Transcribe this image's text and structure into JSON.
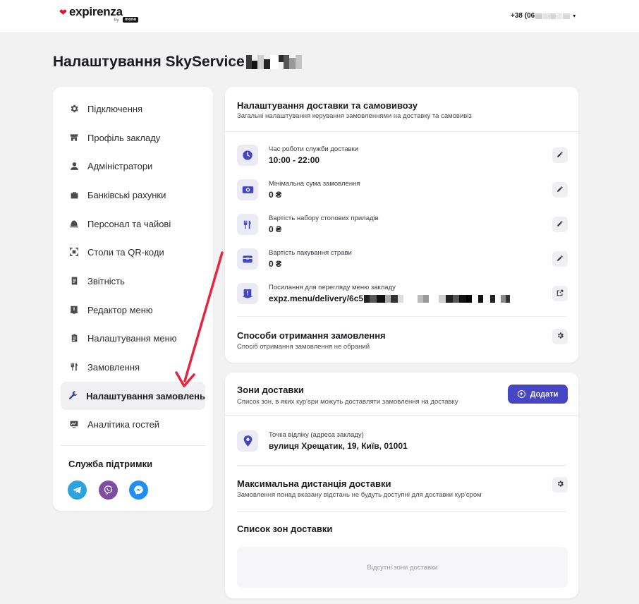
{
  "header": {
    "logo_text": "expirenza",
    "logo_by": "by",
    "logo_mono": "mono",
    "phone_prefix": "+38 (06"
  },
  "page": {
    "title": "Налаштування SkyService"
  },
  "sidebar": {
    "items": [
      {
        "label": "Підключення",
        "icon": "gear-icon"
      },
      {
        "label": "Профіль закладу",
        "icon": "store-icon"
      },
      {
        "label": "Адміністратори",
        "icon": "person-icon"
      },
      {
        "label": "Банківські рахунки",
        "icon": "briefcase-icon"
      },
      {
        "label": "Персонал та чайові",
        "icon": "bell-icon"
      },
      {
        "label": "Столи та QR-коди",
        "icon": "qr-scan-icon"
      },
      {
        "label": "Звітність",
        "icon": "document-icon"
      },
      {
        "label": "Редактор меню",
        "icon": "book-icon"
      },
      {
        "label": "Налаштування меню",
        "icon": "clipboard-icon"
      },
      {
        "label": "Замовлення",
        "icon": "cutlery-icon"
      },
      {
        "label": "Налаштування замовлень",
        "icon": "wrench-icon",
        "active": true
      },
      {
        "label": "Аналітика гостей",
        "icon": "analytics-icon"
      }
    ],
    "support_title": "Служба підтримки",
    "support_channels": [
      "telegram-icon",
      "viber-icon",
      "messenger-icon"
    ]
  },
  "delivery_settings": {
    "title": "Налаштування доставки та самовивозу",
    "subtitle": "Загальні налаштування керування замовленнями на доставку та самовивіз",
    "rows": [
      {
        "label": "Час роботи служби доставки",
        "value": "10:00 - 22:00",
        "icon": "clock-icon",
        "action": "edit-icon"
      },
      {
        "label": "Мінімальна сума замовлення",
        "value": "0 ₴",
        "icon": "money-icon",
        "action": "edit-icon"
      },
      {
        "label": "Вартість набору столових приладів",
        "value": "0 ₴",
        "icon": "cutlery-icon",
        "action": "edit-icon"
      },
      {
        "label": "Вартість пакування страви",
        "value": "0 ₴",
        "icon": "package-icon",
        "action": "edit-icon"
      },
      {
        "label": "Посилання для перегляду меню закладу",
        "value": "expz.menu/delivery/6c5",
        "icon": "menu-book-icon",
        "action": "external-link-icon"
      }
    ],
    "methods_title": "Способи отримання замовлення",
    "methods_sub": "Спосіб отримання замовлення не обраний"
  },
  "delivery_zones": {
    "title": "Зони доставки",
    "subtitle": "Список зон, в яких кур'єри можуть доставляти замовлення на доставку",
    "add_label": "Додати",
    "pickup_label": "Точка відліку (адреса закладу)",
    "pickup_value": "вулиця Хрещатик, 19, Київ, 01001",
    "max_distance_title": "Максимальна дистанція доставки",
    "max_distance_sub": "Замовлення понад вказану відстань не будуть доступні для доставки кур'єром",
    "zones_list_title": "Список зон доставки",
    "zones_empty": "Відсутні зони доставки"
  },
  "colors": {
    "accent": "#4646c5",
    "annotation_arrow": "#e8253f",
    "brand_heart": "#e0132c"
  }
}
